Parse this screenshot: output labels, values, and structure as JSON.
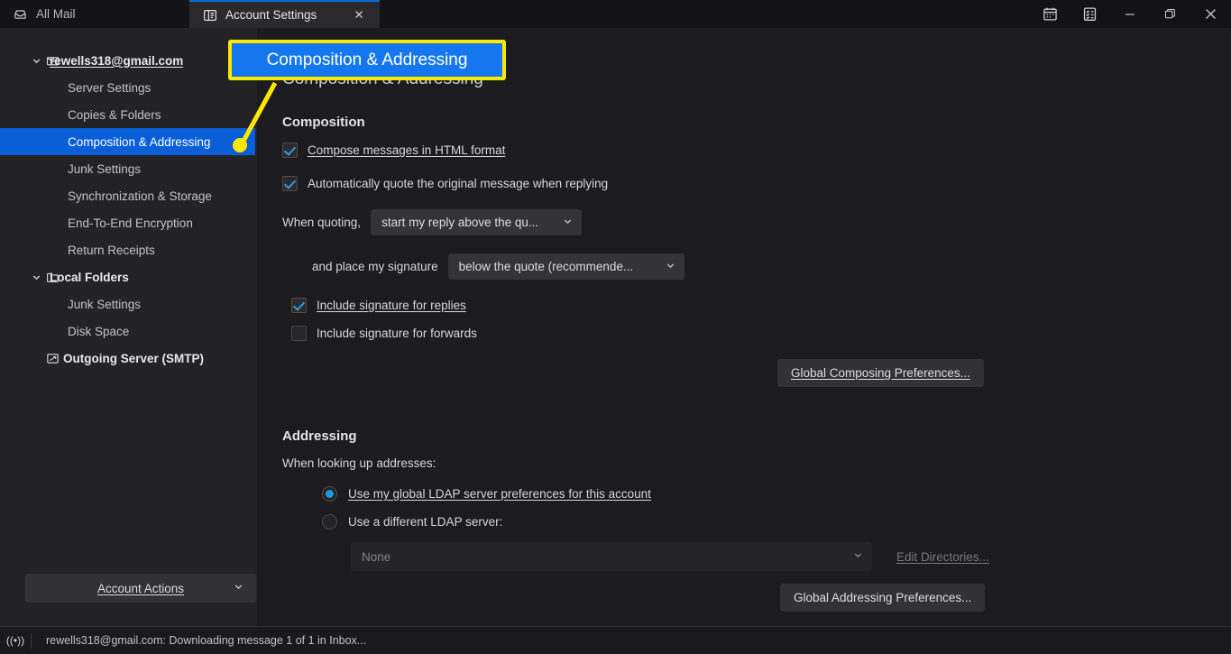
{
  "window": {
    "tabs": [
      {
        "label": "All Mail",
        "icon": "inbox-icon",
        "active": false
      },
      {
        "label": "Account Settings",
        "icon": "account-settings-icon",
        "active": true
      }
    ],
    "close_tab_glyph": "✕",
    "titlebar_buttons": [
      {
        "name": "calendar-icon",
        "glyph": "calendar"
      },
      {
        "name": "tasks-icon",
        "glyph": "tasks"
      },
      {
        "name": "minimize-button",
        "glyph": "—"
      },
      {
        "name": "maximize-button",
        "glyph": "maximize"
      },
      {
        "name": "close-window-button",
        "glyph": "✕"
      }
    ]
  },
  "sidebar": {
    "account_email": "rewells318@gmail.com",
    "items": [
      {
        "label": "Server Settings"
      },
      {
        "label": "Copies & Folders"
      },
      {
        "label": "Composition & Addressing"
      },
      {
        "label": "Junk Settings"
      },
      {
        "label": "Synchronization & Storage"
      },
      {
        "label": "End-To-End Encryption"
      },
      {
        "label": "Return Receipts"
      }
    ],
    "local_folders": {
      "label": "Local Folders",
      "items": [
        {
          "label": "Junk Settings"
        },
        {
          "label": "Disk Space"
        }
      ]
    },
    "outgoing_server": "Outgoing Server (SMTP)",
    "account_actions": "Account Actions"
  },
  "main": {
    "page_title": "Composition & Addressing",
    "composition": {
      "heading": "Composition",
      "compose_html_label": "Compose messages in HTML format",
      "compose_html_checked": true,
      "auto_quote_label": "Automatically quote the original message when replying",
      "auto_quote_checked": true,
      "when_quoting_label": "When quoting,",
      "when_quoting_value": "start my reply above the qu...",
      "place_signature_label": "and place my signature",
      "place_signature_value": "below the quote (recommende...",
      "include_sig_replies_label": "Include signature for replies",
      "include_sig_replies_checked": true,
      "include_sig_forwards_label": "Include signature for forwards",
      "include_sig_forwards_checked": false,
      "global_composing_button": "Global Composing Preferences..."
    },
    "addressing": {
      "heading": "Addressing",
      "lookup_label": "When looking up addresses:",
      "global_ldap_label": "Use my global LDAP server preferences for this account",
      "global_ldap_selected": true,
      "different_ldap_label": "Use a different LDAP server:",
      "different_ldap_selected": false,
      "ldap_server_value": "None",
      "edit_directories_button": "Edit Directories...",
      "global_addressing_button": "Global Addressing Preferences..."
    }
  },
  "statusbar": {
    "text": "rewells318@gmail.com: Downloading message 1 of 1 in Inbox..."
  },
  "callout": {
    "label": "Composition & Addressing"
  },
  "colors": {
    "accent_blue": "#0a5ed7",
    "callout_blue": "#1577f0",
    "callout_yellow": "#ffe800",
    "window_bg": "#1c1b1f",
    "sidebar_bg": "#232326"
  }
}
